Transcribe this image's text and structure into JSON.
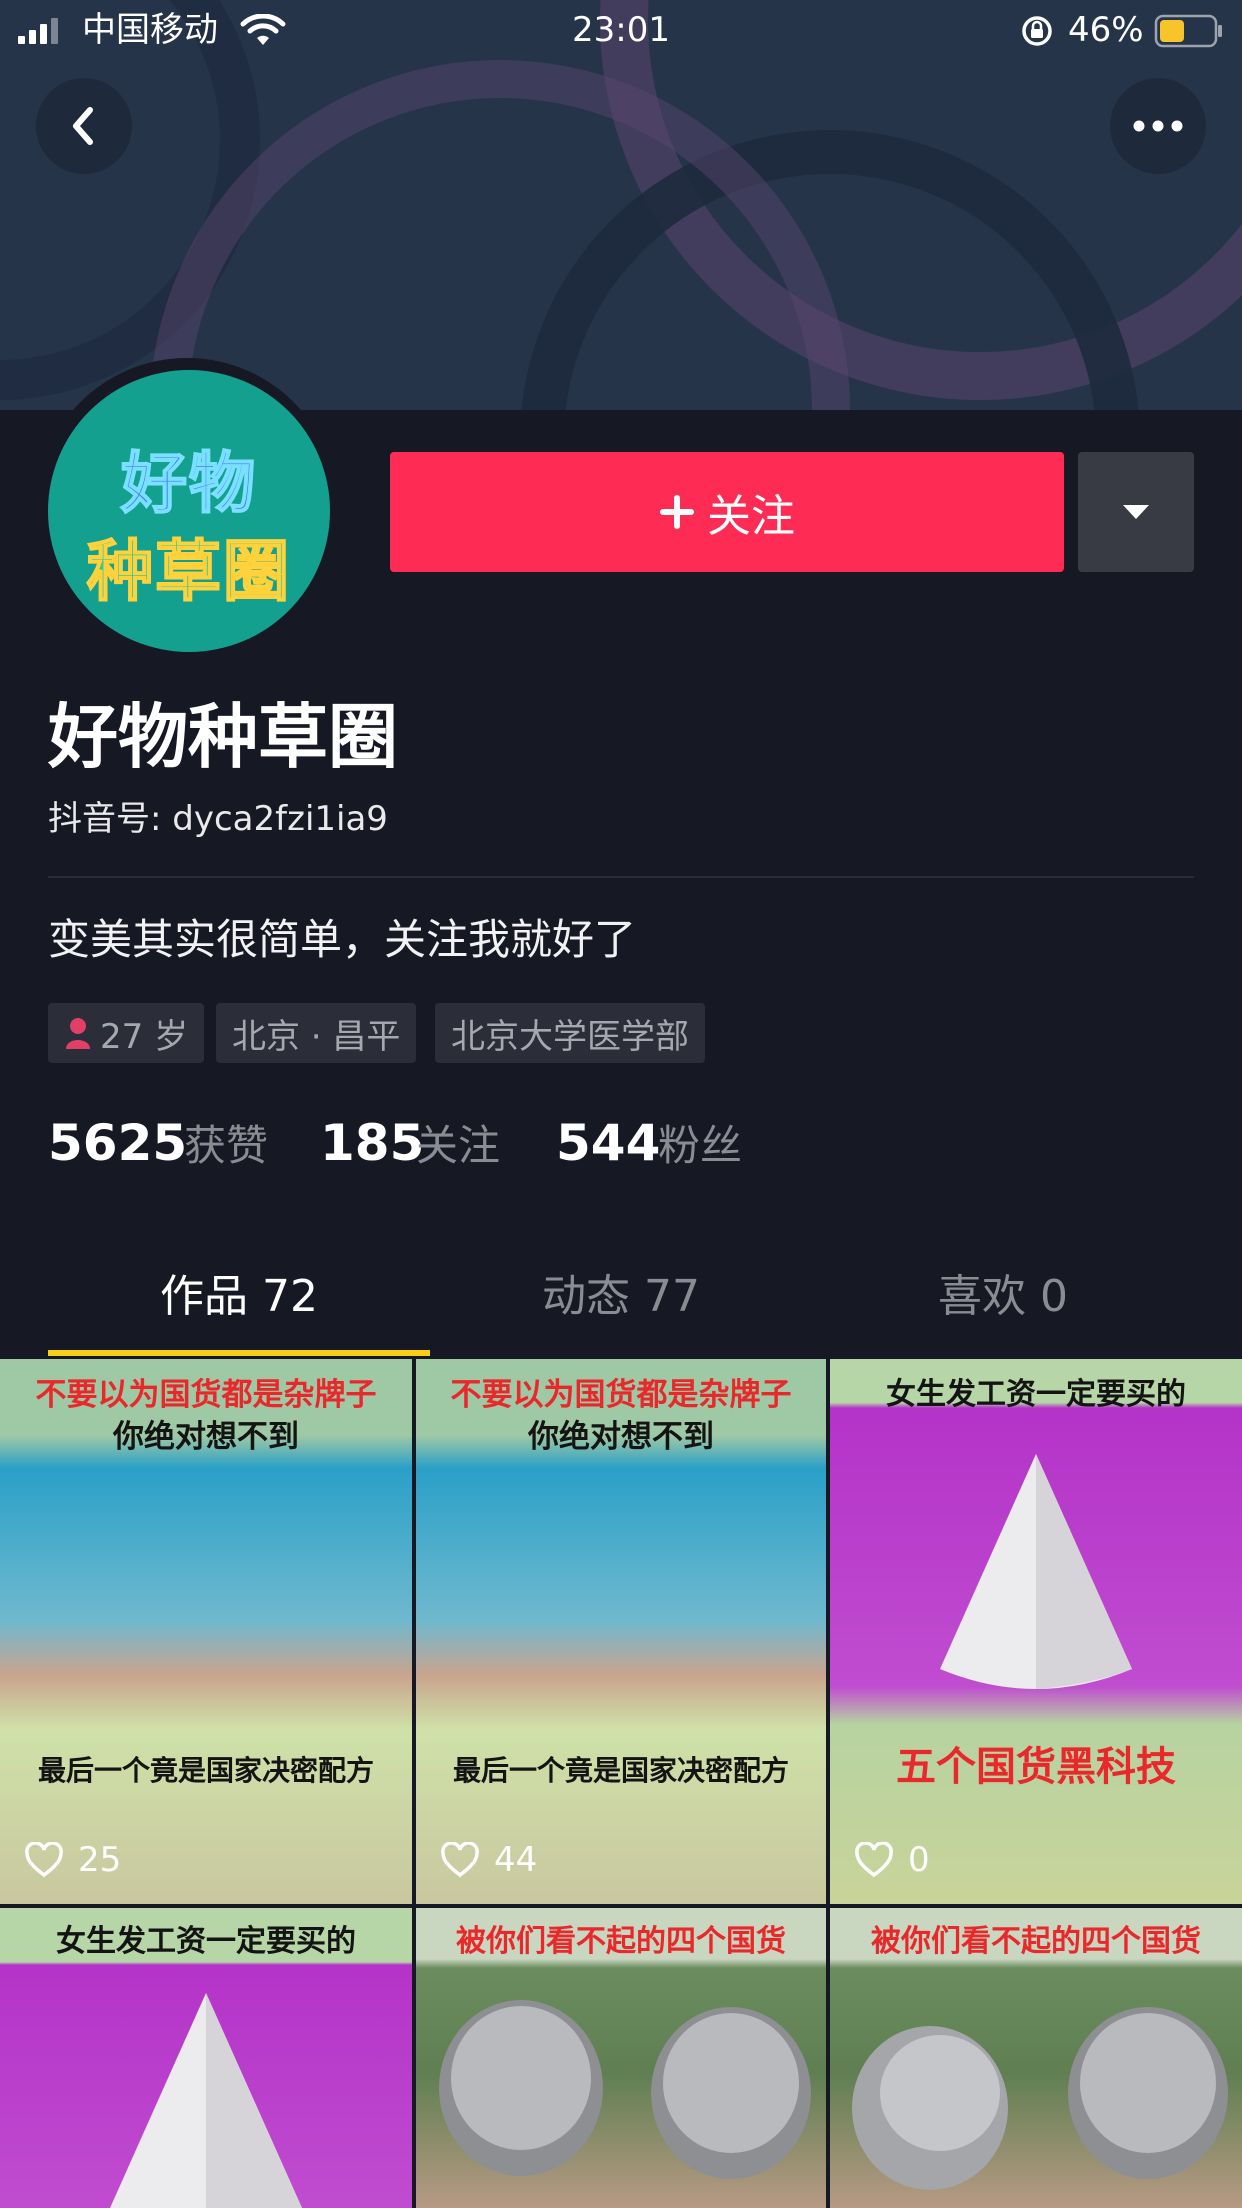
{
  "status_bar": {
    "carrier": "中国移动",
    "time": "23:01",
    "battery_percent": "46%",
    "battery_level": 0.46,
    "icons": [
      "signal-icon",
      "wifi-icon",
      "rotation-lock-icon",
      "battery-icon"
    ]
  },
  "nav": {
    "back_icon": "back-chevron-icon",
    "more_icon": "more-dots-icon"
  },
  "avatar": {
    "line1": "好物",
    "line2": "种草圈",
    "bg_color": "#14a08e"
  },
  "actions": {
    "follow_label": "关注",
    "follow_icon": "plus-icon",
    "follow_color": "#fe2c55",
    "dropdown_icon": "caret-down-icon"
  },
  "profile": {
    "name": "好物种草圈",
    "douyin_id": "抖音号: dyca2fzi1ia9",
    "bio": "变美其实很简单，关注我就好了",
    "tags": [
      {
        "icon": "female-icon",
        "label": "27 岁"
      },
      {
        "label": "北京 · 昌平"
      },
      {
        "label": "北京大学医学部"
      }
    ]
  },
  "stats": [
    {
      "value": "5625",
      "label": "获赞"
    },
    {
      "value": "185",
      "label": "关注"
    },
    {
      "value": "544",
      "label": "粉丝"
    }
  ],
  "tabs": [
    {
      "label": "作品 72",
      "active": true
    },
    {
      "label": "动态 77",
      "active": false
    },
    {
      "label": "喜欢 0",
      "active": false
    }
  ],
  "grid": [
    {
      "top_text": "不要以为国货都是杂牌子",
      "top_text2": "你绝对想不到",
      "bottom_text": "最后一个竟是国家决密配方",
      "likes": "25"
    },
    {
      "top_text": "不要以为国货都是杂牌子",
      "top_text2": "你绝对想不到",
      "bottom_text": "最后一个竟是国家决密配方",
      "likes": "44"
    },
    {
      "top_text": "女生发工资一定要买的",
      "bottom_text": "五个国货黑科技",
      "likes": "0"
    },
    {
      "top_text": "女生发工资一定要买的"
    },
    {
      "top_text": "被你们看不起的四个国货"
    },
    {
      "top_text": "被你们看不起的四个国货"
    }
  ]
}
